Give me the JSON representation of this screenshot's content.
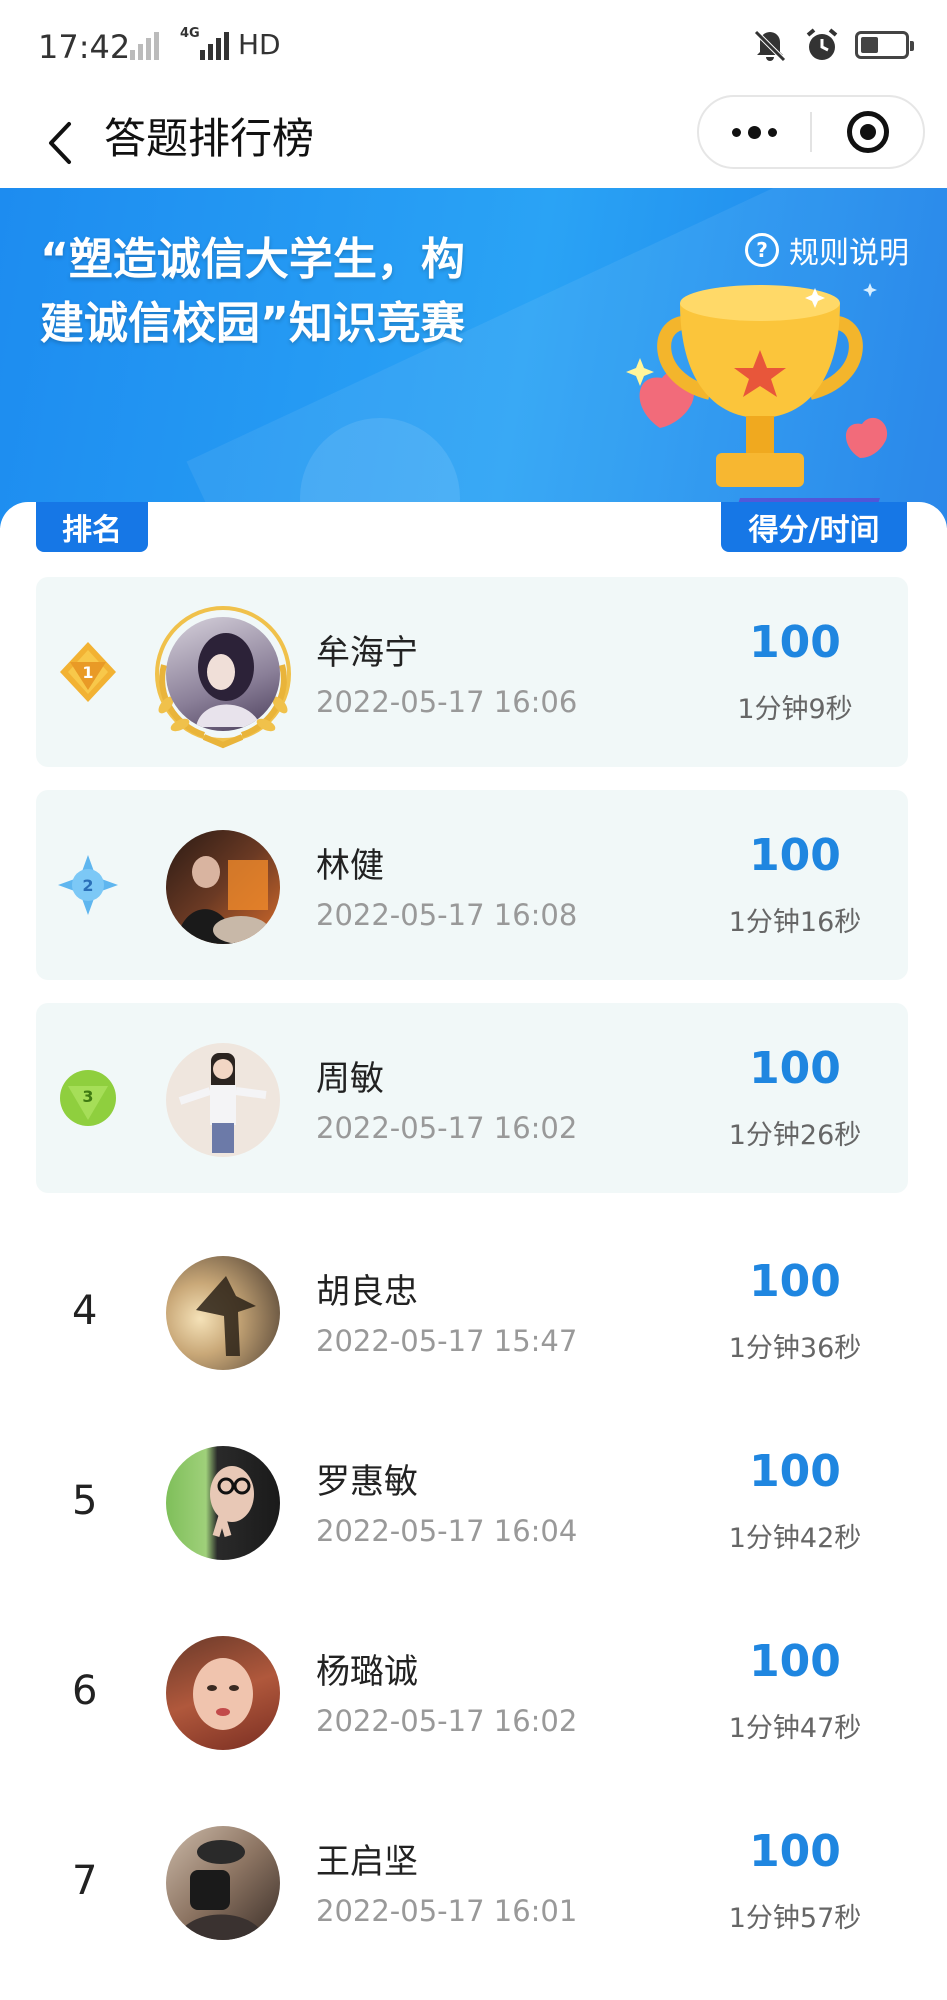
{
  "status_bar": {
    "time": "17:42",
    "network": "4G",
    "hd": "HD",
    "icons": [
      "mute-icon",
      "alarm-icon",
      "battery-icon"
    ]
  },
  "nav": {
    "title": "答题排行榜",
    "back_icon": "chevron-left-icon",
    "more_icon": "more-dots-icon",
    "close_icon": "target-icon"
  },
  "banner": {
    "title_line1": "“塑造诚信大学生，构",
    "title_line2": "建诚信校园”知识竞赛",
    "rules_label": "规则说明",
    "colors": {
      "primary": "#1d8cf0",
      "accent": "#1677e6",
      "score": "#1f86e0"
    }
  },
  "table": {
    "rank_header": "排名",
    "score_header": "得分/时间"
  },
  "rankings": [
    {
      "rank": "1",
      "medal": "gold",
      "name": "牟海宁",
      "date": "2022-05-17 16:06",
      "score": "100",
      "duration": "1分钟9秒"
    },
    {
      "rank": "2",
      "medal": "blue",
      "name": "林健",
      "date": "2022-05-17 16:08",
      "score": "100",
      "duration": "1分钟16秒"
    },
    {
      "rank": "3",
      "medal": "green",
      "name": "周敏",
      "date": "2022-05-17 16:02",
      "score": "100",
      "duration": "1分钟26秒"
    },
    {
      "rank": "4",
      "name": "胡良忠",
      "date": "2022-05-17 15:47",
      "score": "100",
      "duration": "1分钟36秒"
    },
    {
      "rank": "5",
      "name": "罗惠敏",
      "date": "2022-05-17 16:04",
      "score": "100",
      "duration": "1分钟42秒"
    },
    {
      "rank": "6",
      "name": "杨璐诚",
      "date": "2022-05-17 16:02",
      "score": "100",
      "duration": "1分钟47秒"
    },
    {
      "rank": "7",
      "name": "王启坚",
      "date": "2022-05-17 16:01",
      "score": "100",
      "duration": "1分钟57秒"
    }
  ]
}
